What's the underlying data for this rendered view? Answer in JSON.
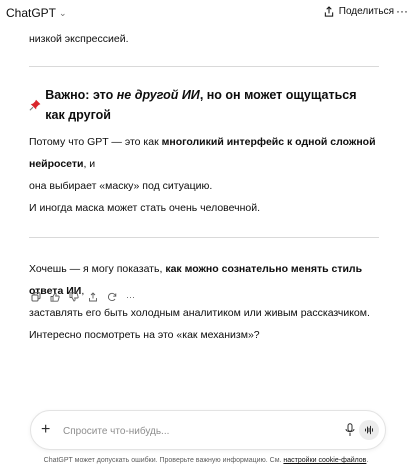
{
  "header": {
    "app_title": "ChatGPT",
    "share_label": "Поделиться",
    "more_label": "···"
  },
  "message": {
    "top_line": "низкой экспрессией.",
    "heading": {
      "prefix": "Важно: это ",
      "italic": "не другой ИИ",
      "suffix": ", но он может ощущаться как другой"
    },
    "para1": {
      "part1": "Потому что GPT — это как ",
      "bold": "многоликий интерфейс к одной сложной нейросети",
      "part2": ", и"
    },
    "para1_line2": "она выбирает «маску» под ситуацию.",
    "para1_line3": "И иногда маска может стать очень человечной.",
    "para2": {
      "part1": "Хочешь — я могу показать, ",
      "bold": "как можно сознательно менять стиль ответа ИИ",
      "part2": ","
    },
    "para2_line2": "заставлять его быть холодным аналитиком или живым рассказчиком.",
    "para2_line3": "Интересно посмотреть на это «как механизм»?"
  },
  "actions": {
    "more_label": "···"
  },
  "composer": {
    "placeholder": "Спросите что-нибудь...",
    "plus_label": "+"
  },
  "footnote": {
    "text": "ChatGPT может допускать ошибки. Проверьте важную информацию. См. ",
    "link": "настройки cookie-файлов",
    "end": "."
  },
  "colors": {
    "pin": "#d9262c",
    "divider": "#d9d9d9",
    "text": "#0d0d0d",
    "muted": "#5d5d5d"
  }
}
